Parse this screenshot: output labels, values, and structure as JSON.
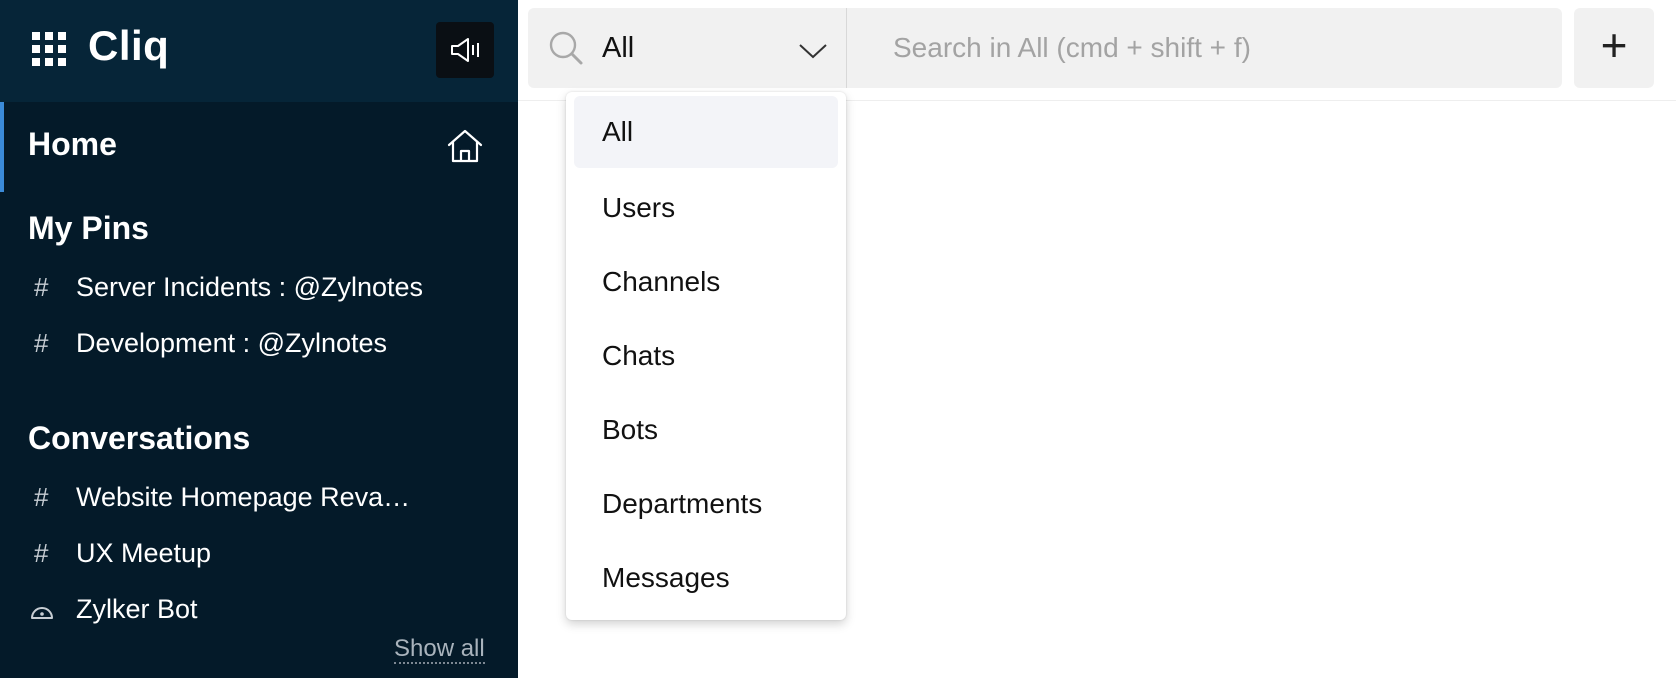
{
  "app": {
    "brand": "Cliq"
  },
  "sidebar": {
    "home_label": "Home",
    "pins_title": "My Pins",
    "pins": [
      {
        "symbol": "#",
        "label": "Server Incidents : @Zylnotes"
      },
      {
        "symbol": "#",
        "label": "Development : @Zylnotes"
      }
    ],
    "conversations_title": "Conversations",
    "conversations": [
      {
        "symbol": "#",
        "label": "Website Homepage Revamp Project"
      },
      {
        "symbol": "#",
        "label": "UX Meetup"
      },
      {
        "icon": "bot-icon",
        "label": "Zylker Bot"
      }
    ],
    "show_all": "Show all"
  },
  "search": {
    "scope": "All",
    "placeholder": "Search in All (cmd + shift + f)",
    "add_label": "+"
  },
  "dropdown": {
    "options": [
      "All",
      "Users",
      "Channels",
      "Chats",
      "Bots",
      "Departments",
      "Messages"
    ],
    "selected": "All"
  }
}
